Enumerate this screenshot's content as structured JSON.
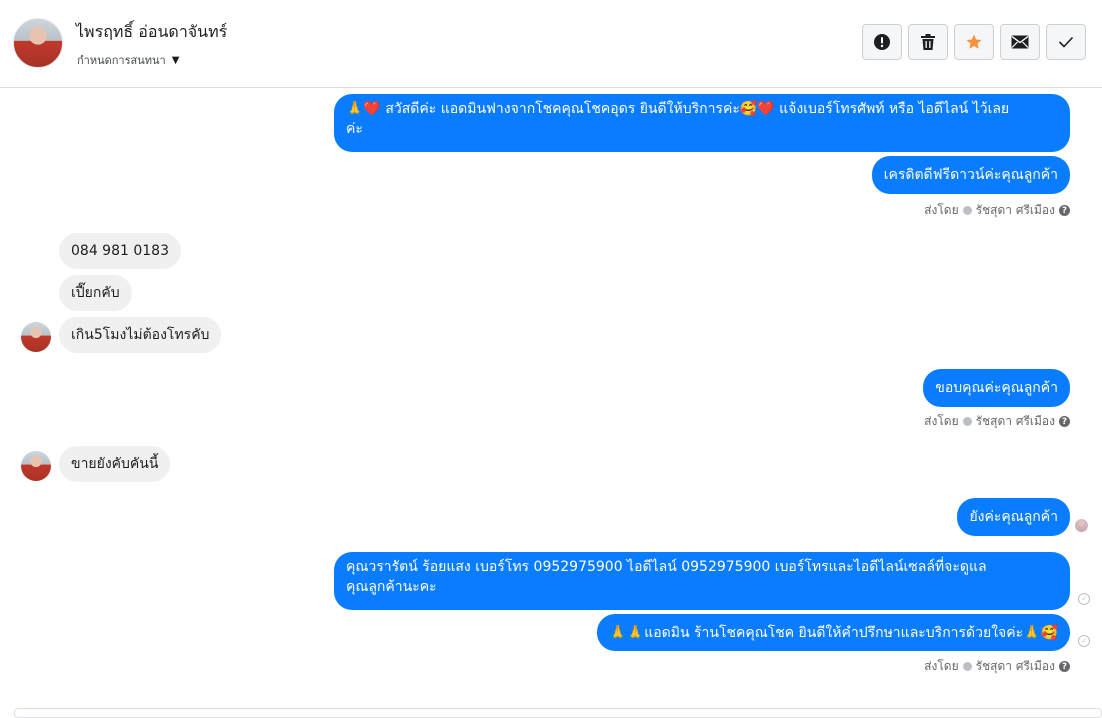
{
  "header": {
    "contact_name": "ไพรฤทธิ์ อ่อนดาจันทร์",
    "assign_label": "กำหนดการสนทนา"
  },
  "toolbar": {
    "buttons": [
      {
        "icon": "alert-circle-icon"
      },
      {
        "icon": "trash-icon"
      },
      {
        "icon": "star-icon",
        "color": "#f7923b"
      },
      {
        "icon": "envelope-icon"
      },
      {
        "icon": "check-icon"
      }
    ]
  },
  "messages": [
    {
      "dir": "out",
      "text_line1": "🙏❤️ สวัสดีค่ะ แอดมินฟางจากโชคคุณโชคอุดร ยินดีให้บริการค่ะ🥰❤️ แจ้งเบอร์โทรศัพท์ หรือ ไอดีไลน์  ไว้เลย",
      "text_line2": "ค่ะ"
    },
    {
      "dir": "out",
      "text": "เครดิตดีฟรีดาวน์ค่ะคุณลูกค้า"
    },
    {
      "dir": "in",
      "text": "084  981  0183"
    },
    {
      "dir": "in",
      "text": "เปี๊ยกคับ"
    },
    {
      "dir": "in",
      "text": "เกิน5โมงไม่ต้องโทรคับ"
    },
    {
      "dir": "out",
      "text": "ขอบคุณค่ะคุณลูกค้า"
    },
    {
      "dir": "in",
      "text": "ขายยังคับคันนี้"
    },
    {
      "dir": "out",
      "text": "ยังค่ะคุณลูกค้า"
    },
    {
      "dir": "out",
      "text_line1": "คุณวรารัตน์ ร้อยแสง       เบอร์โทร 0952975900  ไอดีไลน์ 0952975900  เบอร์โทรและไอดีไลน์เซลล์ที่จะดูแล",
      "text_line2": "คุณลูกค้านะคะ"
    },
    {
      "dir": "out",
      "text": "🙏🙏แอดมิน ร้านโชคคุณโชค ยินดีให้คำปรึกษาและบริการด้วยใจค่ะ🙏🥰"
    }
  ],
  "sent_by": {
    "prefix": "ส่งโดย",
    "name": "รัชสุดา ศรีเมือง"
  },
  "colors": {
    "outgoing_bubble": "#0a7cff",
    "incoming_bubble": "#f0f0f0"
  }
}
